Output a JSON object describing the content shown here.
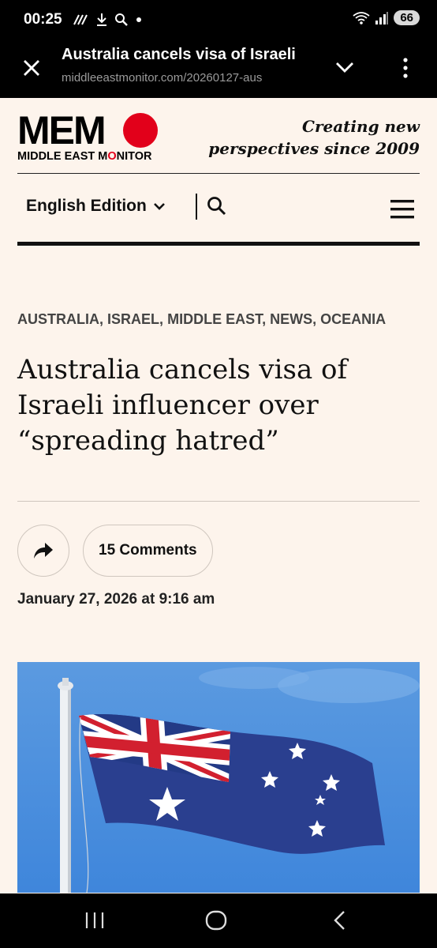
{
  "status_bar": {
    "time": "00:25",
    "battery": "66",
    "network": "5"
  },
  "browser": {
    "tab_title": "Australia cancels visa of Israeli",
    "url": "middleeastmonitor.com/20260127-aus"
  },
  "site": {
    "logo_main": "MEM",
    "logo_sub_before": "MIDDLE EAST M",
    "logo_sub_o": "O",
    "logo_sub_after": "NITOR",
    "tagline_line1": "Creating new",
    "tagline_line2": "perspectives since 2009",
    "edition_label": "English Edition",
    "brand_red": "#e2001a"
  },
  "article": {
    "categories": [
      "AUSTRALIA",
      "ISRAEL",
      "MIDDLE EAST",
      "NEWS",
      "OCEANIA"
    ],
    "category_separator": ",",
    "headline": "Australia cancels visa of Israeli influencer over “spreading hatred”",
    "comments_label": "15 Comments",
    "date": "January 27, 2026 at 9:16 am"
  },
  "icons": {
    "close": "close-icon",
    "chevron": "chevron-down-icon",
    "menu": "kebab-menu-icon",
    "search": "search-icon",
    "hamburger": "hamburger-menu-icon",
    "share": "share-icon"
  }
}
